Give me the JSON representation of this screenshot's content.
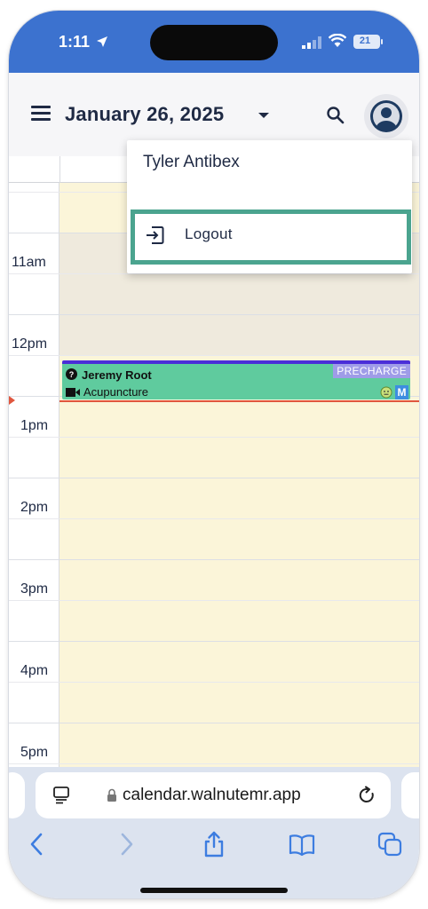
{
  "status_bar": {
    "time": "1:11",
    "battery": "21"
  },
  "header": {
    "date_title": "January 26, 2025"
  },
  "calendar": {
    "hours": [
      "11am",
      "12pm",
      "1pm",
      "2pm",
      "3pm",
      "4pm",
      "5pm"
    ],
    "event": {
      "patient": "Jeremy Root",
      "type": "Acupuncture",
      "badge": "PRECHARGE",
      "marker": "M",
      "accent_color": "#4a2ed8",
      "fill_color": "#5fcb9e"
    }
  },
  "user_menu": {
    "user_name": "Tyler Antibex",
    "logout_label": "Logout",
    "highlight_color": "#4ba48f"
  },
  "browser": {
    "url": "calendar.walnutemr.app"
  },
  "icons": {
    "status": [
      "location-arrow-icon",
      "signal-icon",
      "wifi-icon",
      "battery-icon"
    ],
    "header": [
      "menu-icon",
      "dropdown-caret-icon",
      "search-icon",
      "avatar-icon"
    ],
    "browser": [
      "reader-icon",
      "lock-icon",
      "reload-icon",
      "back-icon",
      "forward-icon",
      "share-icon",
      "bookmarks-icon",
      "tabs-icon"
    ]
  }
}
